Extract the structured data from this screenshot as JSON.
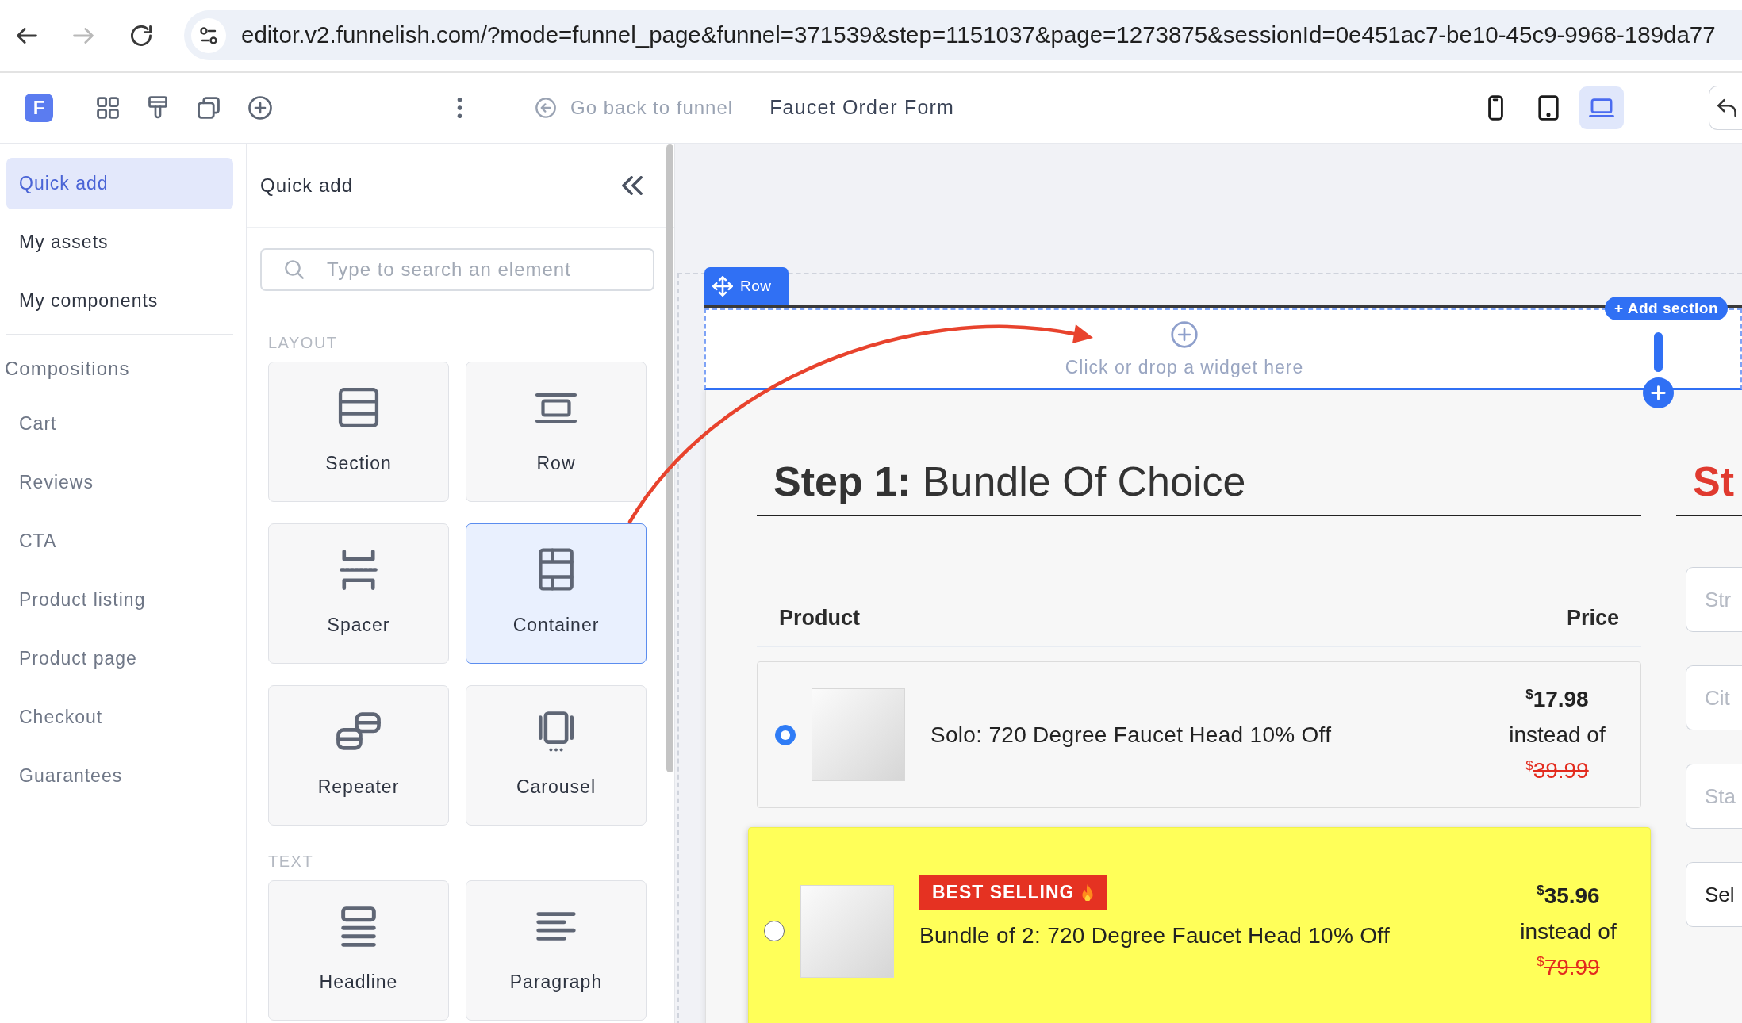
{
  "browser": {
    "nav": [
      {
        "kind": "back",
        "disabled": false
      },
      {
        "kind": "forward",
        "disabled": true
      },
      {
        "kind": "reload",
        "disabled": false
      }
    ],
    "url": "editor.v2.funnelish.com/?mode=funnel_page&funnel=371539&step=1151037&page=1273875&sessionId=0e451ac7-be10-45c9-9968-189da77"
  },
  "toolbar": {
    "logo": "F",
    "back_link": "Go back to funnel",
    "page_title": "Faucet Order Form",
    "devices": [
      {
        "kind": "phone",
        "selected": false
      },
      {
        "kind": "tablet",
        "selected": false
      },
      {
        "kind": "laptop",
        "selected": true
      }
    ]
  },
  "sidebar": {
    "items": [
      {
        "label": "Quick add",
        "selected": true
      },
      {
        "label": "My assets",
        "selected": false
      },
      {
        "label": "My components",
        "selected": false
      }
    ],
    "section": "Compositions",
    "compositions": [
      {
        "label": "Cart",
        "selected": false
      },
      {
        "label": "Reviews",
        "selected": false
      },
      {
        "label": "CTA",
        "selected": false
      },
      {
        "label": "Product listing",
        "selected": false
      },
      {
        "label": "Product page",
        "selected": false
      },
      {
        "label": "Checkout",
        "selected": false
      },
      {
        "label": "Guarantees",
        "selected": false
      }
    ]
  },
  "quick_add": {
    "title": "Quick add",
    "search": {
      "placeholder": "Type to search an element"
    },
    "groups": [
      {
        "heading": "LAYOUT",
        "elements": [
          {
            "kind": "section",
            "label": "Section",
            "selected": false
          },
          {
            "kind": "row",
            "label": "Row",
            "selected": false
          },
          {
            "kind": "spacer",
            "label": "Spacer",
            "selected": false
          },
          {
            "kind": "container",
            "label": "Container",
            "selected": true
          },
          {
            "kind": "repeater",
            "label": "Repeater",
            "selected": false
          },
          {
            "kind": "carousel",
            "label": "Carousel",
            "selected": false
          }
        ]
      },
      {
        "heading": "TEXT",
        "elements": [
          {
            "kind": "headline",
            "label": "Headline",
            "selected": false
          },
          {
            "kind": "paragraph",
            "label": "Paragraph",
            "selected": false
          }
        ]
      }
    ]
  },
  "canvas": {
    "row_tag": "Row",
    "add_section": "+ Add section",
    "drop_hint": "Click or drop a widget here",
    "order": {
      "heading": "**Step 1:** Bundle Of Choice",
      "columns": [
        "Product",
        "Price"
      ],
      "rows": [
        {
          "selected": true,
          "highlighted": false,
          "title": "Solo: 720 Degree Faucet Head 10% Off",
          "currency": "$",
          "price": "17.98",
          "note": "instead of",
          "old_currency": "$",
          "old_price": "39.99"
        },
        {
          "selected": false,
          "highlighted": true,
          "badge": "BEST SELLING",
          "title": "Bundle of 2: 720 Degree Faucet Head 10% Off",
          "currency": "$",
          "price": "35.96",
          "note": "instead of",
          "old_currency": "$",
          "old_price": "79.99"
        }
      ]
    },
    "next_step": {
      "heading": "St",
      "fields": [
        {
          "placeholder": "Str"
        },
        {
          "placeholder": "Cit"
        },
        {
          "placeholder": "Sta"
        },
        {
          "value": "Sel"
        }
      ]
    }
  }
}
